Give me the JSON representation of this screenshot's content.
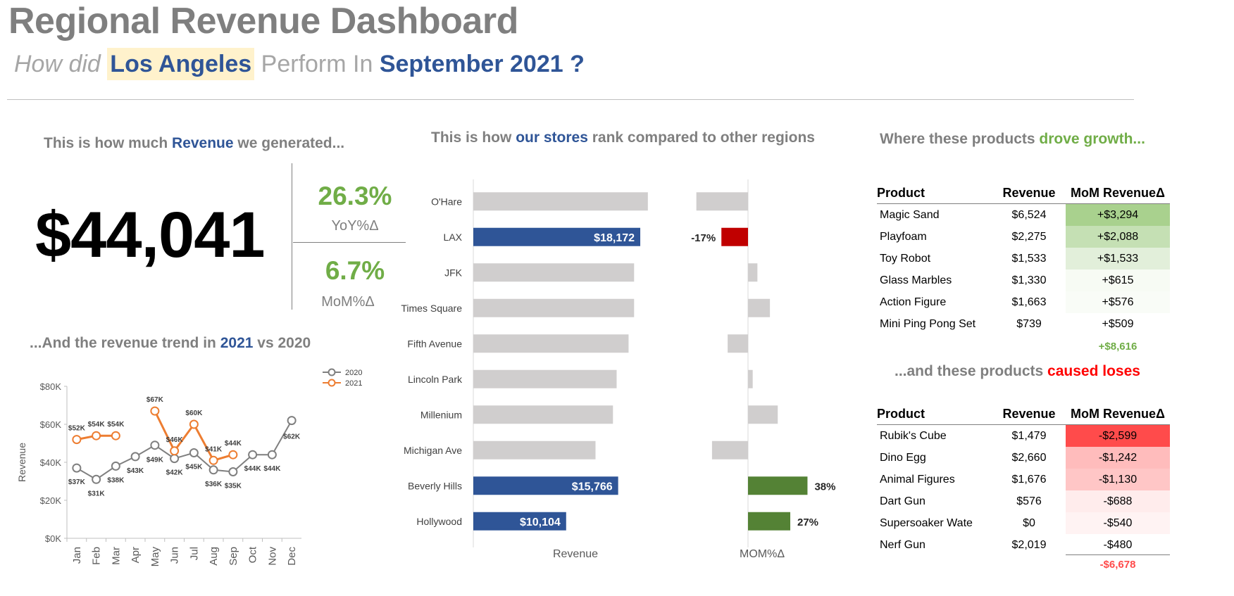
{
  "header": {
    "title": "Regional Revenue Dashboard",
    "q_pre": "How did",
    "q_city": "Los Angeles",
    "q_mid": "Perform In",
    "q_month": "September 2021 ?"
  },
  "revenue_section": {
    "head_pre": "This is how much",
    "head_hl": "Revenue",
    "head_post": "we generated...",
    "total": "$44,041",
    "yoy_value": "26.3%",
    "yoy_label": "YoY%Δ",
    "mom_value": "6.7%",
    "mom_label": "MoM%Δ"
  },
  "trend_section": {
    "head_pre": "...And the revenue trend in",
    "head_hl": "2021",
    "head_post": "vs 2020"
  },
  "rank_section": {
    "head_pre": "This is how",
    "head_hl": "our stores",
    "head_post": "rank compared to other regions",
    "revenue_axis_label": "Revenue",
    "mom_axis_label": "MOM%Δ"
  },
  "growth_section": {
    "head_pre": "Where these products",
    "head_hl": "drove growth...",
    "col_product": "Product",
    "col_revenue": "Revenue",
    "col_delta": "MoM RevenueΔ",
    "rows": [
      {
        "product": "Magic Sand",
        "revenue": "$6,524",
        "delta": "+$3,294",
        "bg": "#a9d18e"
      },
      {
        "product": "Playfoam",
        "revenue": "$2,275",
        "delta": "+$2,088",
        "bg": "#c5e0b4"
      },
      {
        "product": "Toy Robot",
        "revenue": "$1,533",
        "delta": "+$1,533",
        "bg": "#e2efda"
      },
      {
        "product": "Glass Marbles",
        "revenue": "$1,330",
        "delta": "+$615",
        "bg": "#f7fbf4"
      },
      {
        "product": "Action Figure",
        "revenue": "$1,663",
        "delta": "+$576",
        "bg": "#f9fcf7"
      },
      {
        "product": "Mini Ping Pong Set",
        "revenue": "$739",
        "delta": "+$509",
        "bg": "#ffffff"
      }
    ],
    "total": "+$8,616"
  },
  "loss_section": {
    "head_pre": "...and these products",
    "head_hl": "caused loses",
    "col_product": "Product",
    "col_revenue": "Revenue",
    "col_delta": "MoM RevenueΔ",
    "rows": [
      {
        "product": "Rubik's Cube",
        "revenue": "$1,479",
        "delta": "-$2,599",
        "bg": "#ff4b4b"
      },
      {
        "product": "Dino Egg",
        "revenue": "$2,660",
        "delta": "-$1,242",
        "bg": "#ffbcbc"
      },
      {
        "product": "Animal Figures",
        "revenue": "$1,676",
        "delta": "-$1,130",
        "bg": "#ffc6c6"
      },
      {
        "product": "Dart Gun",
        "revenue": "$576",
        "delta": "-$688",
        "bg": "#ffecec"
      },
      {
        "product": "Supersoaker Wate",
        "revenue": "$0",
        "delta": "-$540",
        "bg": "#fff3f3"
      },
      {
        "product": "Nerf Gun",
        "revenue": "$2,019",
        "delta": "-$480",
        "bg": "#ffffff"
      }
    ],
    "total": "-$6,678"
  },
  "colors": {
    "brand_blue": "#2f5597",
    "positive_green": "#70ad47",
    "bar_green": "#548235",
    "negative_red": "#c00000",
    "bar_grey": "#d0cece",
    "line_2020": "#7f7f7f",
    "line_2021": "#ed7d31"
  },
  "chart_data": [
    {
      "type": "line",
      "title": "",
      "xlabel": "",
      "ylabel": "Revenue",
      "categories": [
        "Jan",
        "Feb",
        "Mar",
        "Apr",
        "May",
        "Jun",
        "Jul",
        "Aug",
        "Sep",
        "Oct",
        "Nov",
        "Dec"
      ],
      "ylim": [
        0,
        80000
      ],
      "yticks": [
        "$0K",
        "$20K",
        "$40K",
        "$60K",
        "$80K"
      ],
      "series": [
        {
          "name": "2020",
          "values": [
            37000,
            31000,
            38000,
            43000,
            49000,
            42000,
            45000,
            36000,
            35000,
            44000,
            44000,
            62000
          ],
          "labels": [
            "$37K",
            "$31K",
            "$38K",
            "$43K",
            "$49K",
            "$42K",
            "$45K",
            "$36K",
            "$35K",
            "$44K",
            "$44K",
            "$62K"
          ]
        },
        {
          "name": "2021",
          "values": [
            52000,
            54000,
            54000,
            null,
            67000,
            46000,
            60000,
            41000,
            44000,
            null,
            null,
            null
          ],
          "labels": [
            "$52K",
            "$54K",
            "$54K",
            "",
            "$67K",
            "$46K",
            "$60K",
            "$41K",
            "$44K",
            "",
            "",
            ""
          ]
        }
      ],
      "legend": "top-right",
      "grid": false
    },
    {
      "type": "bar",
      "orientation": "horizontal",
      "title": "",
      "xlabel": "Revenue",
      "categories": [
        "O'Hare",
        "LAX",
        "JFK",
        "Times Square",
        "Fifth Avenue",
        "Lincoln Park",
        "Millenium",
        "Michigan Ave",
        "Beverly Hills",
        "Hollywood"
      ],
      "values": [
        19000,
        18172,
        17500,
        17500,
        16900,
        15600,
        15200,
        13300,
        15766,
        10104
      ],
      "highlighted": [
        "LAX",
        "Beverly Hills",
        "Hollywood"
      ],
      "labels": [
        "",
        "$18,172",
        "",
        "",
        "",
        "",
        "",
        "",
        "$15,766",
        "$10,104"
      ],
      "xlim": [
        0,
        23000
      ]
    },
    {
      "type": "bar",
      "orientation": "horizontal",
      "title": "",
      "xlabel": "MOM%Δ",
      "categories": [
        "O'Hare",
        "LAX",
        "JFK",
        "Times Square",
        "Fifth Avenue",
        "Lincoln Park",
        "Millenium",
        "Michigan Ave",
        "Beverly Hills",
        "Hollywood"
      ],
      "values": [
        -33,
        -17,
        6,
        14,
        -13,
        3,
        19,
        -23,
        38,
        27
      ],
      "labels": [
        "",
        "-17%",
        "",
        "",
        "",
        "",
        "",
        "",
        "38%",
        "27%"
      ],
      "xlim": [
        -40,
        45
      ]
    }
  ]
}
